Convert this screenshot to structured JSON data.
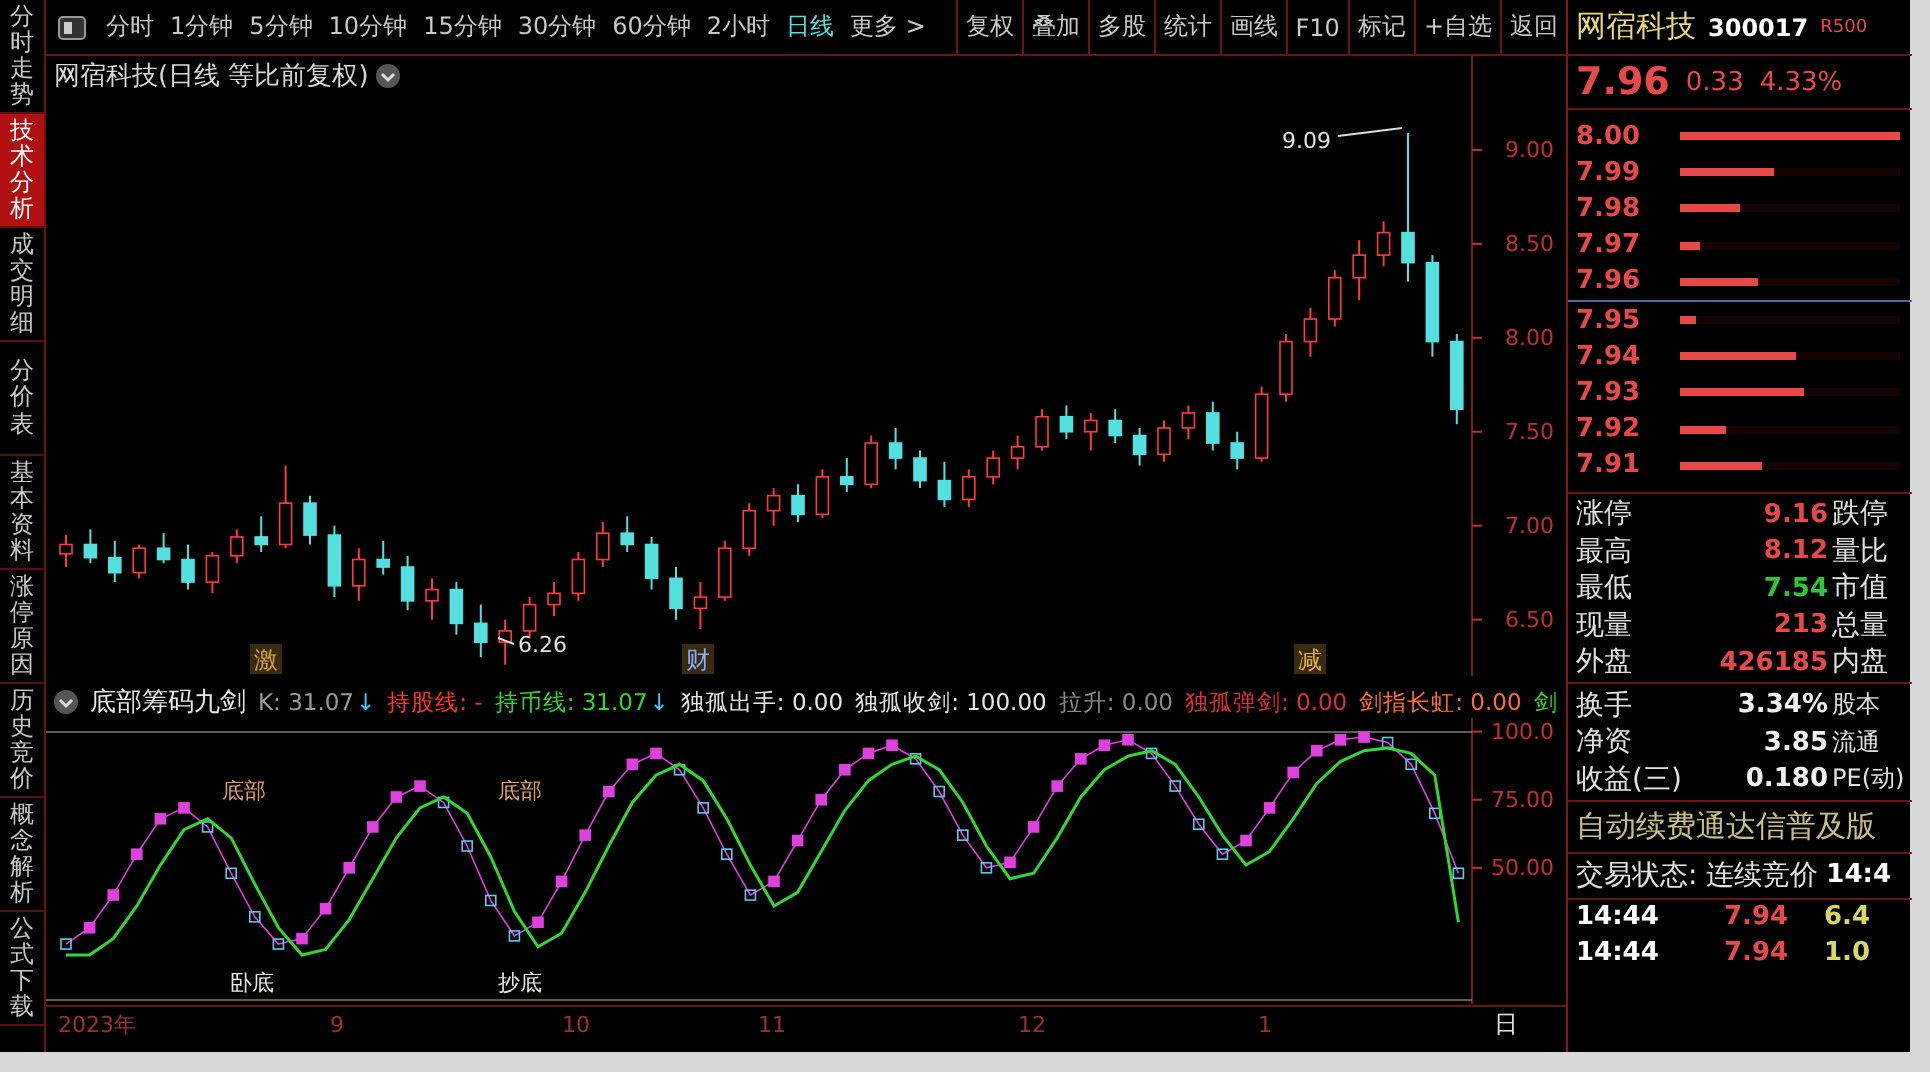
{
  "sidebar": {
    "tabs": [
      {
        "label": "分时走势",
        "selected": false
      },
      {
        "label": "技术分析",
        "selected": true
      },
      {
        "label": "成交明细",
        "selected": false
      },
      {
        "label": "分价表",
        "selected": false
      },
      {
        "label": "基本资料",
        "selected": false
      },
      {
        "label": "涨停原因",
        "selected": false
      },
      {
        "label": "历史竞价",
        "selected": false
      },
      {
        "label": "概念解析",
        "selected": false
      },
      {
        "label": "公式下载",
        "selected": false
      }
    ]
  },
  "toolbar": {
    "periods": [
      {
        "label": "分时",
        "selected": false
      },
      {
        "label": "1分钟",
        "selected": false
      },
      {
        "label": "5分钟",
        "selected": false
      },
      {
        "label": "10分钟",
        "selected": false
      },
      {
        "label": "15分钟",
        "selected": false
      },
      {
        "label": "30分钟",
        "selected": false
      },
      {
        "label": "60分钟",
        "selected": false
      },
      {
        "label": "2小时",
        "selected": false
      },
      {
        "label": "日线",
        "selected": true
      },
      {
        "label": "更多 >",
        "selected": false
      }
    ],
    "actions": [
      "复权",
      "叠加",
      "多股",
      "统计",
      "画线",
      "F10",
      "标记",
      "+自选",
      "返回"
    ]
  },
  "chart": {
    "title": "网宿科技(日线 等比前复权)",
    "high_label": "9.09",
    "low_label": "6.26",
    "markers": [
      "激",
      "财",
      "减"
    ],
    "chart_data": {
      "type": "candlestick",
      "ylim": [
        6.2,
        9.5
      ],
      "yticks": [
        {
          "value": 9,
          "label": "9.00"
        },
        {
          "value": 8.5,
          "label": "8.50"
        },
        {
          "value": 8,
          "label": "8.00"
        },
        {
          "value": 7.5,
          "label": "7.50"
        },
        {
          "value": 7,
          "label": "7.00"
        },
        {
          "value": 6.5,
          "label": "6.50"
        }
      ],
      "ohlc": [
        [
          6.85,
          6.95,
          6.78,
          6.9
        ],
        [
          6.9,
          6.98,
          6.8,
          6.83
        ],
        [
          6.83,
          6.92,
          6.7,
          6.75
        ],
        [
          6.75,
          6.9,
          6.72,
          6.88
        ],
        [
          6.88,
          6.96,
          6.8,
          6.82
        ],
        [
          6.82,
          6.9,
          6.66,
          6.7
        ],
        [
          6.7,
          6.86,
          6.64,
          6.84
        ],
        [
          6.84,
          6.98,
          6.8,
          6.94
        ],
        [
          6.94,
          7.05,
          6.86,
          6.9
        ],
        [
          6.9,
          7.32,
          6.88,
          7.12
        ],
        [
          7.12,
          7.16,
          6.9,
          6.95
        ],
        [
          6.95,
          7.0,
          6.62,
          6.68
        ],
        [
          6.68,
          6.88,
          6.6,
          6.82
        ],
        [
          6.82,
          6.92,
          6.74,
          6.78
        ],
        [
          6.78,
          6.84,
          6.55,
          6.6
        ],
        [
          6.6,
          6.72,
          6.5,
          6.66
        ],
        [
          6.66,
          6.7,
          6.42,
          6.48
        ],
        [
          6.48,
          6.58,
          6.3,
          6.38
        ],
        [
          6.38,
          6.5,
          6.26,
          6.44
        ],
        [
          6.44,
          6.62,
          6.4,
          6.58
        ],
        [
          6.58,
          6.7,
          6.52,
          6.64
        ],
        [
          6.64,
          6.86,
          6.6,
          6.82
        ],
        [
          6.82,
          7.02,
          6.78,
          6.96
        ],
        [
          6.96,
          7.05,
          6.86,
          6.9
        ],
        [
          6.9,
          6.94,
          6.66,
          6.72
        ],
        [
          6.72,
          6.78,
          6.5,
          6.56
        ],
        [
          6.56,
          6.7,
          6.45,
          6.62
        ],
        [
          6.62,
          6.92,
          6.6,
          6.88
        ],
        [
          6.88,
          7.12,
          6.84,
          7.08
        ],
        [
          7.08,
          7.2,
          7.0,
          7.16
        ],
        [
          7.16,
          7.22,
          7.02,
          7.06
        ],
        [
          7.06,
          7.3,
          7.04,
          7.26
        ],
        [
          7.26,
          7.36,
          7.18,
          7.22
        ],
        [
          7.22,
          7.48,
          7.2,
          7.44
        ],
        [
          7.44,
          7.52,
          7.3,
          7.36
        ],
        [
          7.36,
          7.4,
          7.2,
          7.24
        ],
        [
          7.24,
          7.34,
          7.1,
          7.14
        ],
        [
          7.14,
          7.3,
          7.1,
          7.26
        ],
        [
          7.26,
          7.4,
          7.22,
          7.36
        ],
        [
          7.36,
          7.48,
          7.3,
          7.42
        ],
        [
          7.42,
          7.62,
          7.4,
          7.58
        ],
        [
          7.58,
          7.64,
          7.46,
          7.5
        ],
        [
          7.5,
          7.6,
          7.4,
          7.56
        ],
        [
          7.56,
          7.62,
          7.44,
          7.48
        ],
        [
          7.48,
          7.52,
          7.32,
          7.38
        ],
        [
          7.38,
          7.56,
          7.34,
          7.52
        ],
        [
          7.52,
          7.64,
          7.46,
          7.6
        ],
        [
          7.6,
          7.66,
          7.4,
          7.44
        ],
        [
          7.44,
          7.5,
          7.3,
          7.36
        ],
        [
          7.36,
          7.74,
          7.34,
          7.7
        ],
        [
          7.7,
          8.02,
          7.66,
          7.98
        ],
        [
          7.98,
          8.16,
          7.9,
          8.1
        ],
        [
          8.1,
          8.36,
          8.06,
          8.32
        ],
        [
          8.32,
          8.52,
          8.2,
          8.44
        ],
        [
          8.44,
          8.62,
          8.38,
          8.56
        ],
        [
          8.56,
          9.09,
          8.3,
          8.4
        ],
        [
          8.4,
          8.44,
          7.9,
          7.98
        ],
        [
          7.98,
          8.02,
          7.54,
          7.62
        ]
      ]
    }
  },
  "indicator": {
    "name": "底部筹码九剑",
    "values": [
      {
        "text": "K: 31.07",
        "color": "#9a9a9a",
        "arrow": "↓"
      },
      {
        "text": "持股线: -",
        "color": "#ff3030"
      },
      {
        "text": "持币线: 31.07",
        "color": "#30d830",
        "arrow": "↓"
      },
      {
        "text": "独孤出手: 0.00",
        "color": "#e8e8e8"
      },
      {
        "text": "独孤收剑: 100.00",
        "color": "#e8e8e8"
      },
      {
        "text": "拉升: 0.00",
        "color": "#8a8a8a"
      },
      {
        "text": "独孤弹剑: 0.00",
        "color": "#e03030"
      },
      {
        "text": "剑指长虹: 0.00",
        "color": "#ff7030"
      },
      {
        "text": "剑",
        "color": "#30d830"
      }
    ],
    "chart_data": {
      "type": "line",
      "ylim": [
        0,
        105
      ],
      "yticks": [
        {
          "value": 100,
          "label": "100.0"
        },
        {
          "value": 75,
          "label": "75.00"
        },
        {
          "value": 50,
          "label": "50.00"
        }
      ],
      "series": [
        {
          "color": "#e040e0",
          "marker": "square",
          "values": [
            22,
            28,
            40,
            55,
            68,
            72,
            65,
            48,
            32,
            22,
            24,
            35,
            50,
            65,
            76,
            80,
            74,
            58,
            38,
            25,
            30,
            45,
            62,
            78,
            88,
            92,
            86,
            72,
            55,
            40,
            45,
            60,
            75,
            86,
            92,
            95,
            90,
            78,
            62,
            50,
            52,
            65,
            80,
            90,
            95,
            97,
            92,
            80,
            66,
            55,
            60,
            72,
            85,
            93,
            97,
            98,
            96,
            88,
            70,
            48
          ]
        },
        {
          "color": "#30d830",
          "values": [
            18,
            18,
            24,
            36,
            51,
            64,
            68,
            61,
            44,
            28,
            18,
            20,
            31,
            46,
            61,
            72,
            76,
            70,
            54,
            34,
            21,
            26,
            41,
            58,
            74,
            84,
            88,
            82,
            68,
            51,
            36,
            41,
            56,
            71,
            82,
            88,
            91,
            86,
            74,
            58,
            46,
            48,
            61,
            76,
            86,
            91,
            93,
            88,
            76,
            62,
            51,
            56,
            68,
            81,
            89,
            93,
            94,
            92,
            84,
            30
          ]
        }
      ]
    },
    "labels": [
      "底部",
      "底部",
      "卧底",
      "抄底"
    ]
  },
  "date_axis": [
    "2023年",
    "9",
    "10",
    "11",
    "12",
    "1"
  ],
  "period_tag": "日",
  "quote": {
    "name": "网宿科技",
    "code": "300017",
    "badge": "R500",
    "price": "7.96",
    "change": "0.33",
    "percent": "4.33%",
    "book": [
      {
        "price": "8.00",
        "level": 1.0
      },
      {
        "price": "7.99",
        "level": 0.43
      },
      {
        "price": "7.98",
        "level": 0.27
      },
      {
        "price": "7.97",
        "level": 0.09
      },
      {
        "price": "7.96",
        "level": 0.35
      },
      {
        "price": "7.95",
        "level": 0.07
      },
      {
        "price": "7.94",
        "level": 0.53
      },
      {
        "price": "7.93",
        "level": 0.56
      },
      {
        "price": "7.92",
        "level": 0.21
      },
      {
        "price": "7.91",
        "level": 0.37
      }
    ],
    "stats": [
      {
        "label": "涨停",
        "value": "9.16",
        "label2": "跌停",
        "color": "#e84848"
      },
      {
        "label": "最高",
        "value": "8.12",
        "label2": "量比",
        "color": "#e84848"
      },
      {
        "label": "最低",
        "value": "7.54",
        "label2": "市值",
        "color": "#30c830"
      },
      {
        "label": "现量",
        "value": "213",
        "label2": "总量",
        "color": "#e84848"
      },
      {
        "label": "外盘",
        "value": "426185",
        "label2": "内盘",
        "color": "#e84848"
      }
    ],
    "stats2": [
      {
        "label": "换手",
        "value": "3.34%",
        "label2": "股本",
        "color": "#f0f0f0"
      },
      {
        "label": "净资",
        "value": "3.85",
        "label2": "流通",
        "color": "#f0f0f0"
      },
      {
        "label": "收益(三)",
        "value": "0.180",
        "label2": "PE(动)",
        "color": "#f0f0f0"
      }
    ],
    "banner": "自动续费通达信普及版",
    "status": "交易状态: 连续竞价",
    "status_time": "14:4",
    "ticks": [
      {
        "time": "14:44",
        "price": "7.94",
        "volume": "6.4"
      },
      {
        "time": "14:44",
        "price": "7.94",
        "volume": "1.0"
      }
    ]
  }
}
